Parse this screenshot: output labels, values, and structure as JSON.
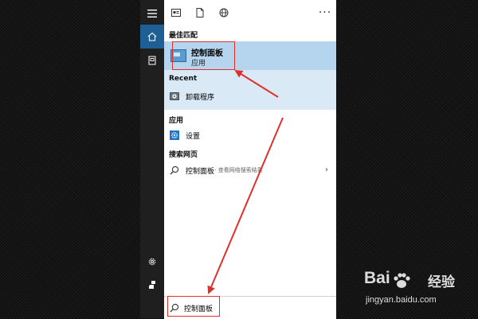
{
  "rail": {
    "items": [
      {
        "icon": "hamburger-menu-icon"
      },
      {
        "icon": "home-icon",
        "active": true
      },
      {
        "icon": "document-icon"
      },
      {
        "icon": "settings-gear-icon"
      },
      {
        "icon": "user-icon"
      }
    ]
  },
  "topbar": {
    "icons": [
      "apps-icon",
      "documents-icon",
      "web-globe-icon"
    ],
    "more_label": "···"
  },
  "sections": {
    "best_match": "最佳匹配",
    "recent": "Recent",
    "apps": "应用",
    "web": "搜索网页"
  },
  "best_match": {
    "title": "控制面板",
    "subtitle": "应用",
    "icon": "control-panel-icon"
  },
  "recent_items": [
    {
      "label": "卸载程序",
      "icon": "uninstall-program-icon"
    }
  ],
  "app_items": [
    {
      "label": "设置",
      "icon": "settings-app-icon"
    }
  ],
  "web_items": [
    {
      "label": "控制面板",
      "hint": " - 查看网络搜索结果",
      "icon": "search-icon",
      "arrow": "›"
    }
  ],
  "search": {
    "query": "控制面板"
  },
  "watermark": {
    "brand_left": "Bai",
    "brand_right": "经验",
    "url": "jingyan.baidu.com"
  },
  "colors": {
    "accent": "#1e5f95",
    "best_match_bg": "#b5d4ee",
    "recent_bg": "#dae9f6",
    "annotation_red": "#e0302c"
  }
}
